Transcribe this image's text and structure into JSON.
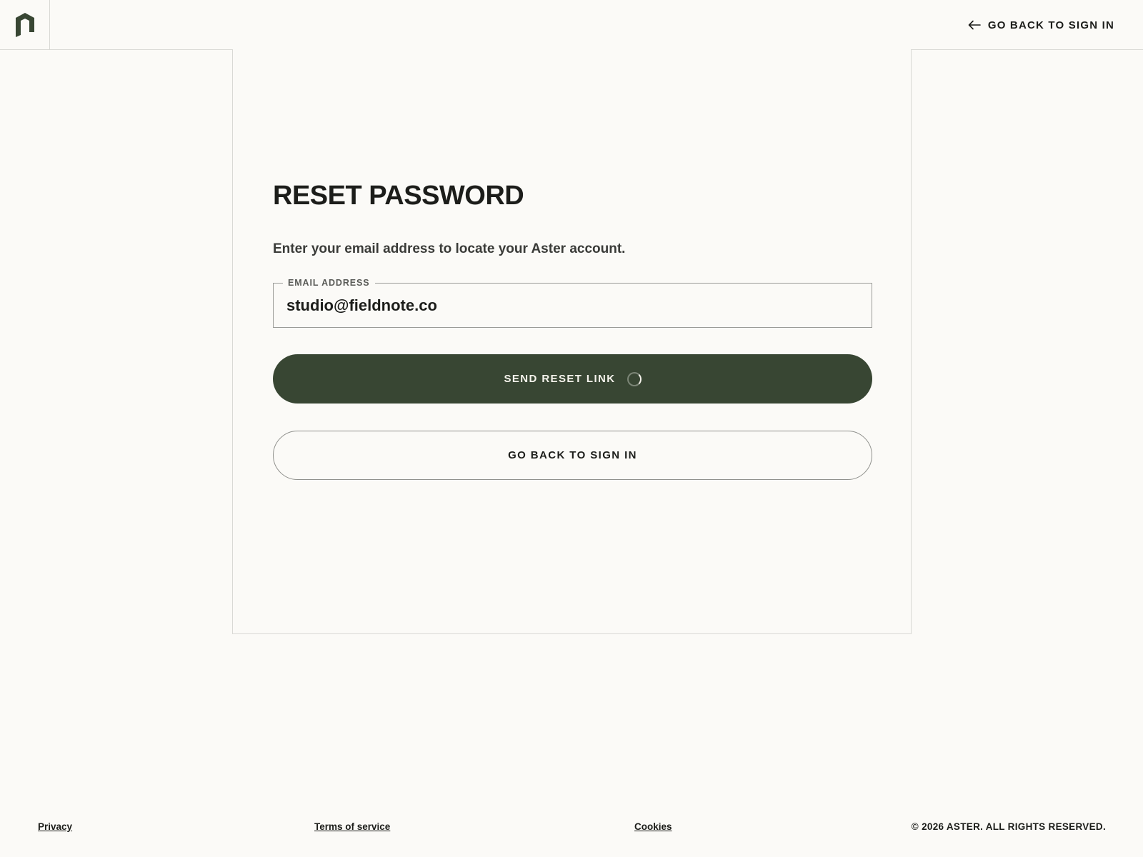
{
  "header": {
    "logo_icon": "brand-mark-icon",
    "back_link_label": "GO BACK TO SIGN IN",
    "back_link_icon": "arrow-left-icon"
  },
  "form": {
    "title": "RESET PASSWORD",
    "subtitle": "Enter your email address to locate your Aster account.",
    "email": {
      "label": "EMAIL ADDRESS",
      "value": "studio@fieldnote.co"
    },
    "send_button_label": "SEND RESET LINK",
    "send_button_state": "loading",
    "back_button_label": "GO BACK TO SIGN IN"
  },
  "footer": {
    "privacy": "Privacy",
    "terms": "Terms of service",
    "cookies": "Cookies",
    "copyright": "© 2026 ASTER. ALL RIGHTS RESERVED."
  },
  "colors": {
    "background": "#fbfaf7",
    "primary_button": "#384633",
    "text": "#1c1d1a",
    "border": "#d9d9d5"
  }
}
